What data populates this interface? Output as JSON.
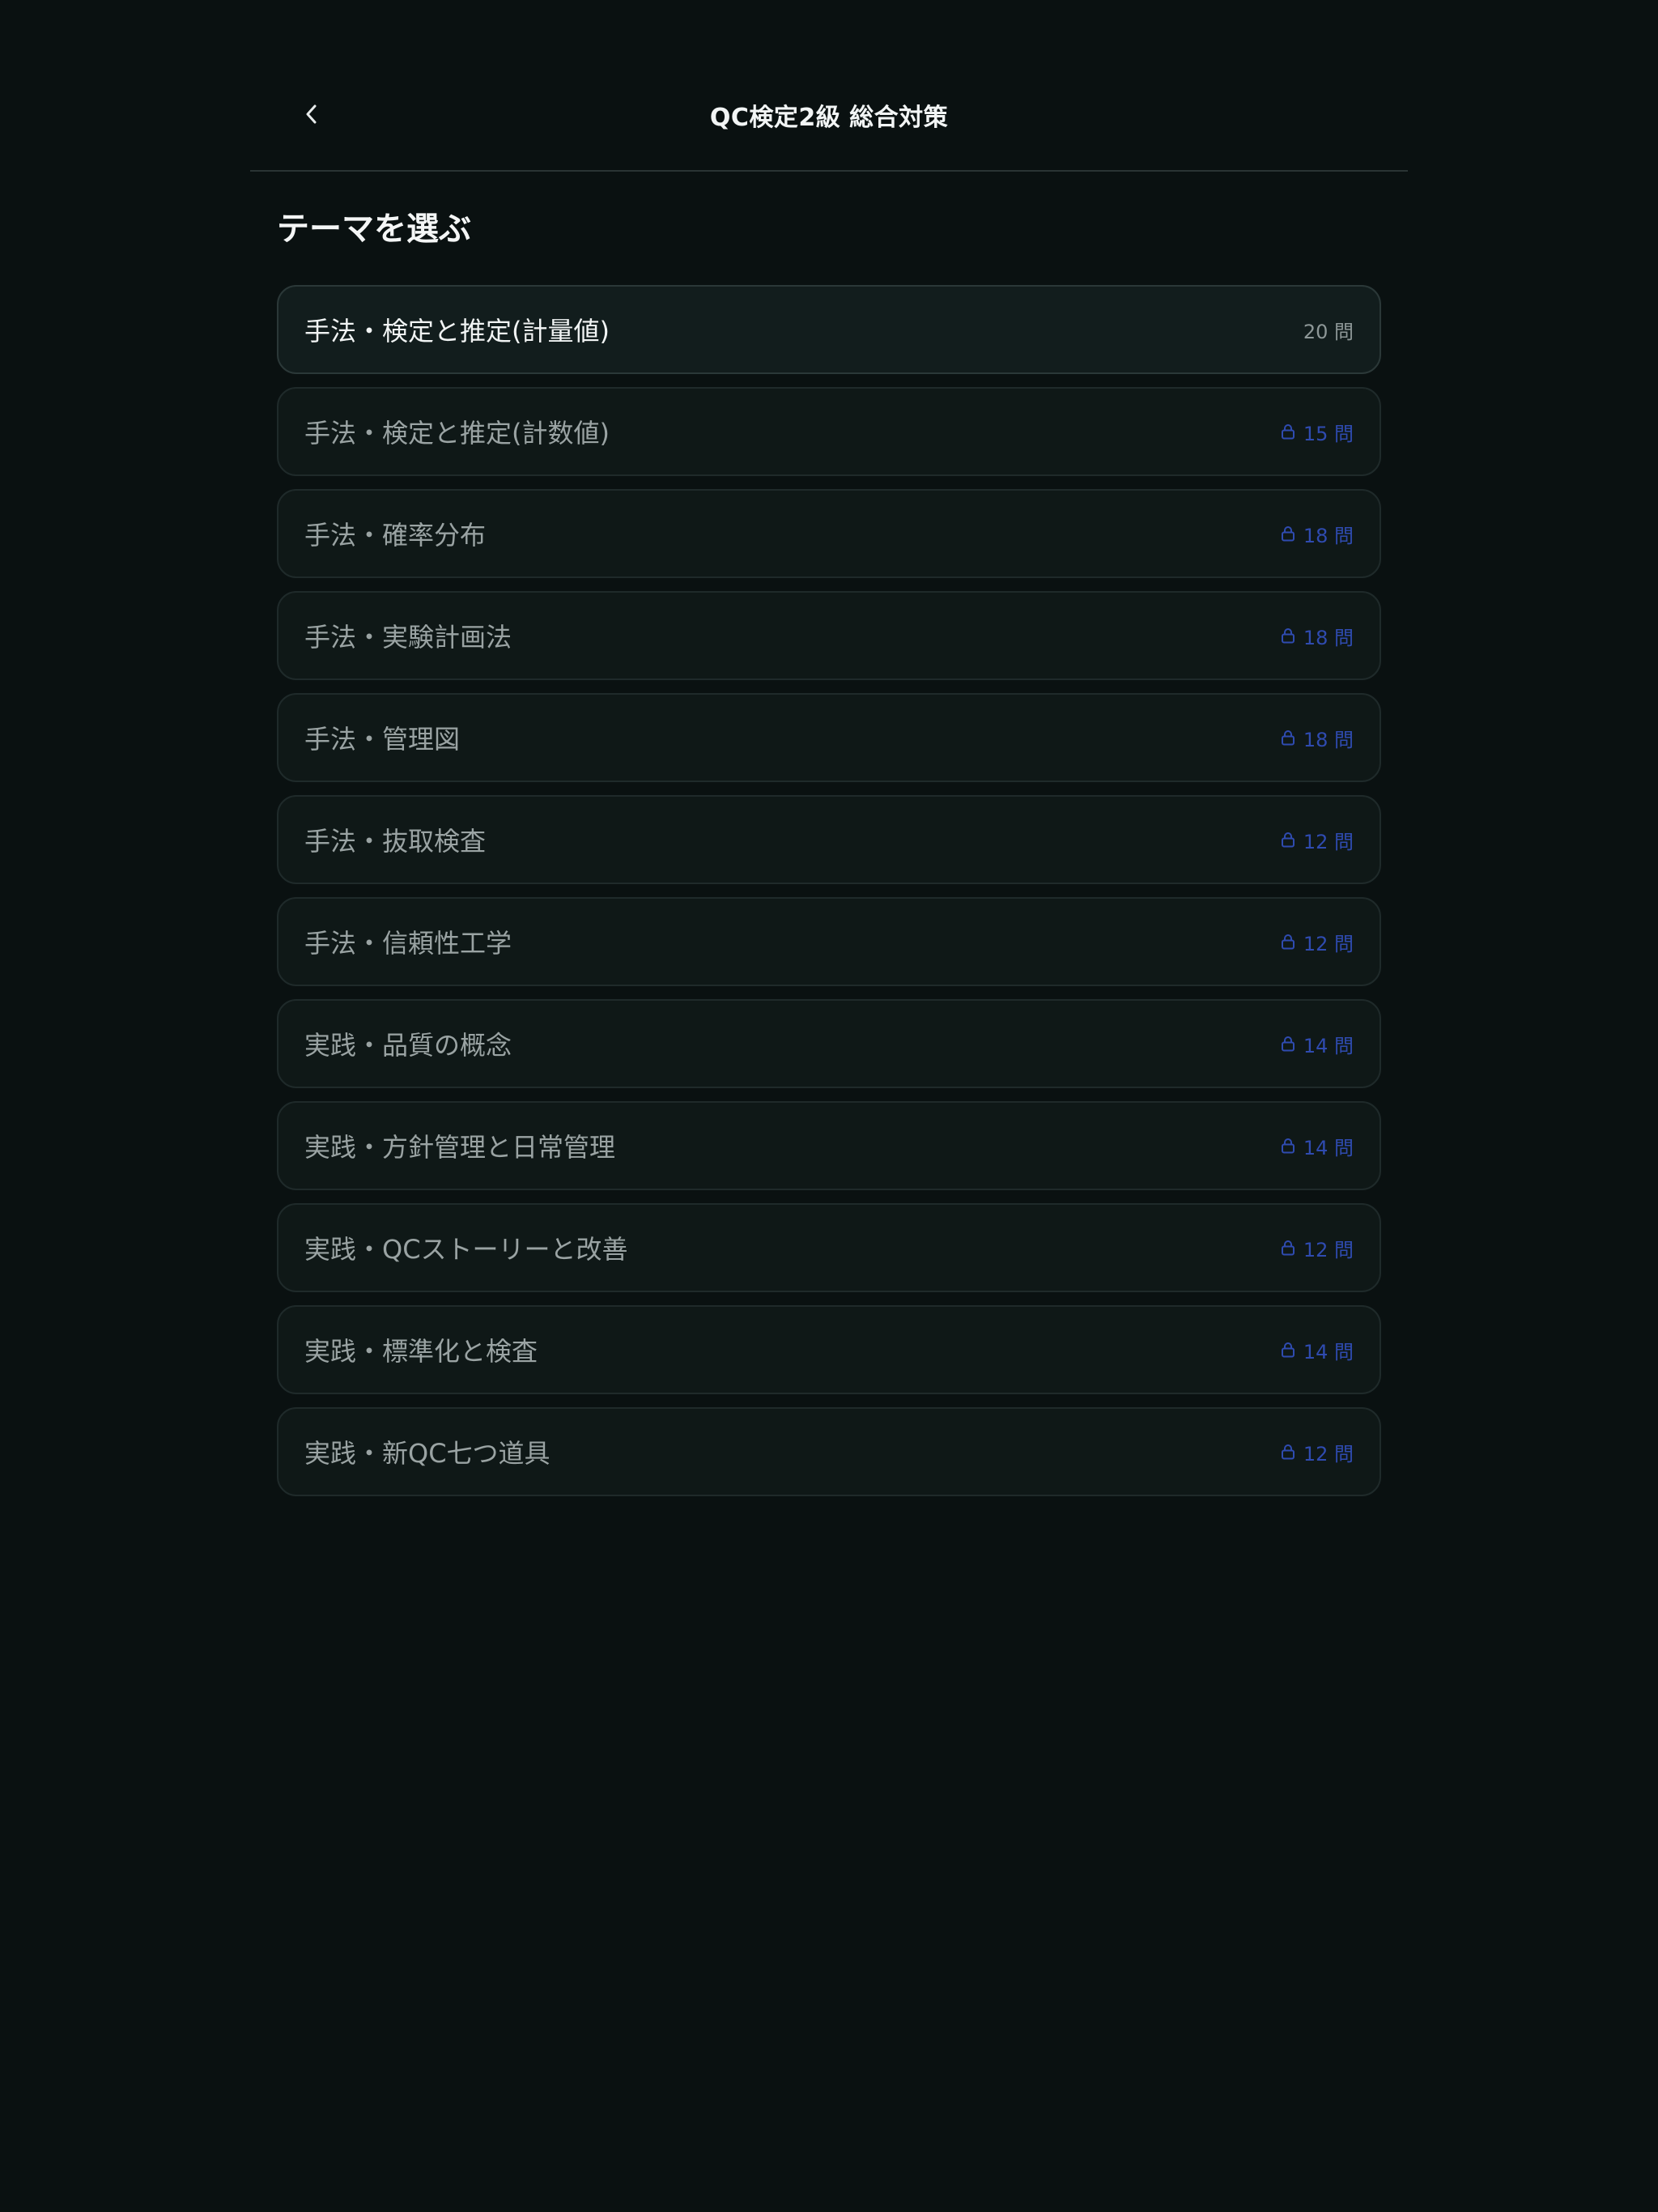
{
  "header": {
    "title": "QC検定2級 総合対策",
    "back_icon": "chevron-left-icon"
  },
  "section_title": "テーマを選ぶ",
  "colors": {
    "background": "#0a1111",
    "card": "#0f1817",
    "locked_accent": "#2f4bb0"
  },
  "themes": [
    {
      "label": "手法・検定と推定(計量値)",
      "count": "20 問",
      "locked": false
    },
    {
      "label": "手法・検定と推定(計数値)",
      "count": "15 問",
      "locked": true
    },
    {
      "label": "手法・確率分布",
      "count": "18 問",
      "locked": true
    },
    {
      "label": "手法・実験計画法",
      "count": "18 問",
      "locked": true
    },
    {
      "label": "手法・管理図",
      "count": "18 問",
      "locked": true
    },
    {
      "label": "手法・抜取検査",
      "count": "12 問",
      "locked": true
    },
    {
      "label": "手法・信頼性工学",
      "count": "12 問",
      "locked": true
    },
    {
      "label": "実践・品質の概念",
      "count": "14 問",
      "locked": true
    },
    {
      "label": "実践・方針管理と日常管理",
      "count": "14 問",
      "locked": true
    },
    {
      "label": "実践・QCストーリーと改善",
      "count": "12 問",
      "locked": true
    },
    {
      "label": "実践・標準化と検査",
      "count": "14 問",
      "locked": true
    },
    {
      "label": "実践・新QC七つ道具",
      "count": "12 問",
      "locked": true
    }
  ]
}
